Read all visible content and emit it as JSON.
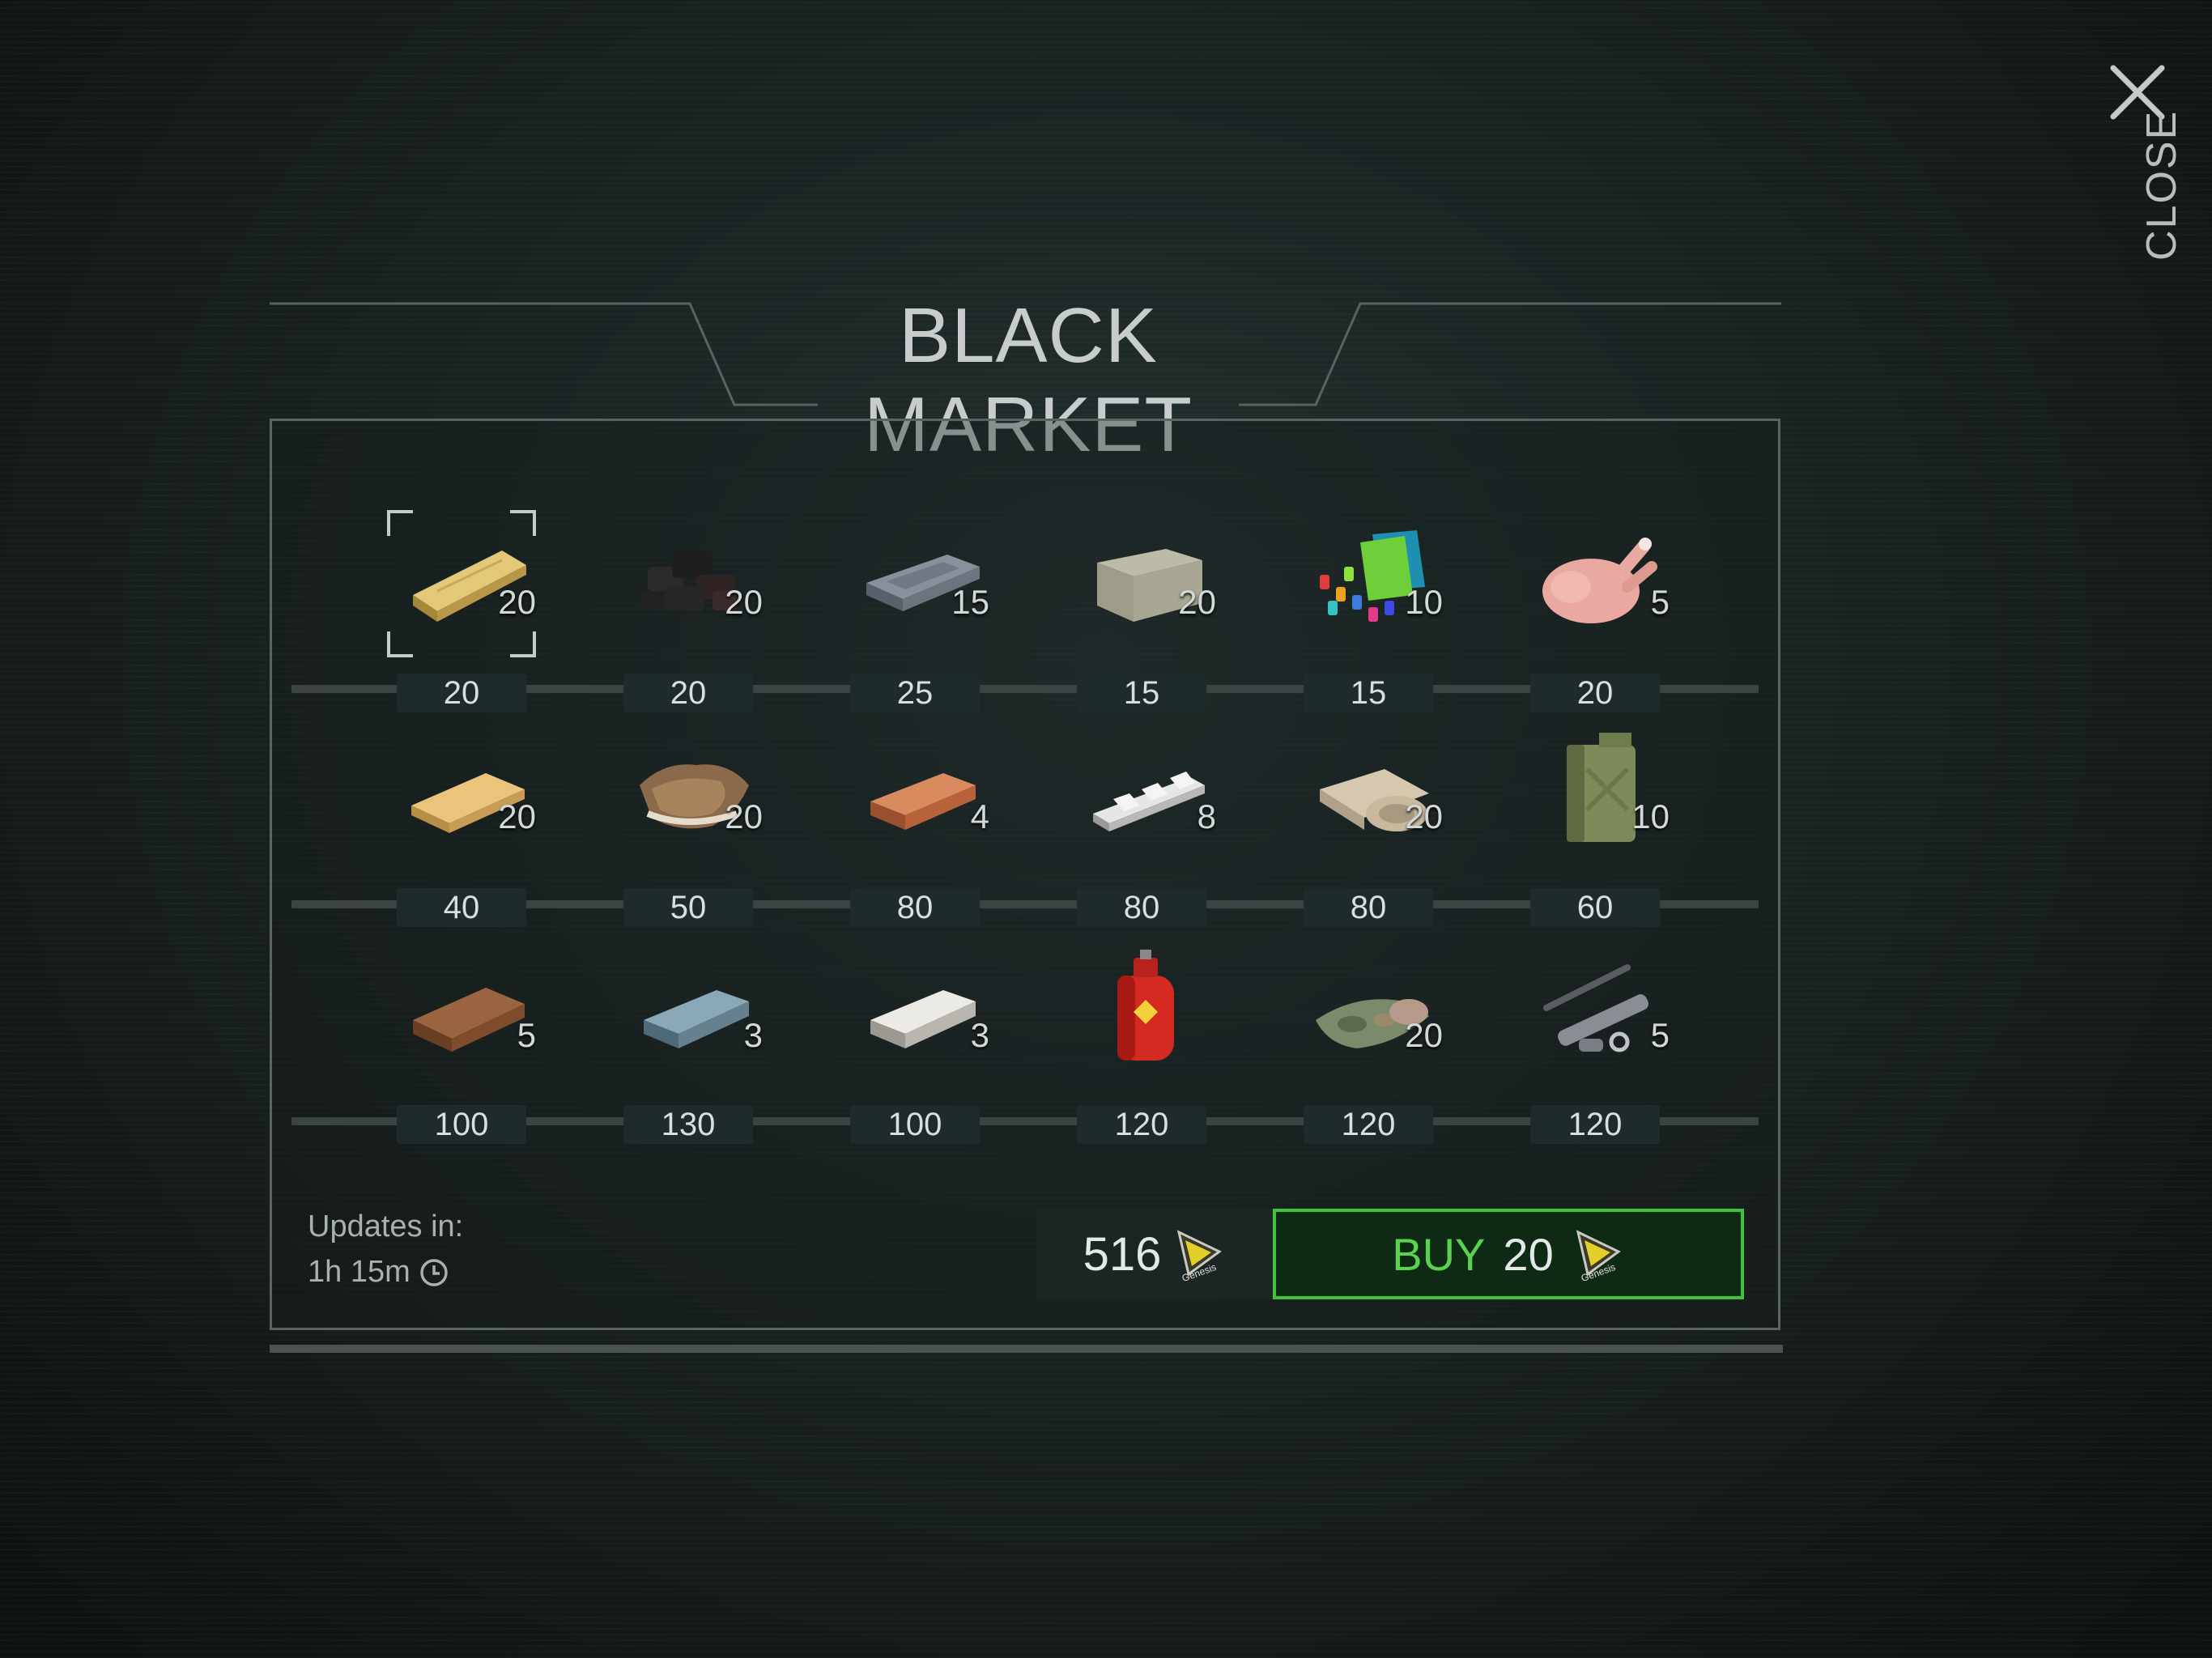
{
  "close": {
    "label": "CLOSE"
  },
  "title": "BLACK MARKET",
  "rows": [
    {
      "items": [
        {
          "icon": "wood-plank-icon",
          "qty": "20",
          "price": "20",
          "selected": true
        },
        {
          "icon": "coal-icon",
          "qty": "20",
          "price": "20"
        },
        {
          "icon": "iron-ingot-icon",
          "qty": "15",
          "price": "25"
        },
        {
          "icon": "stone-block-icon",
          "qty": "20",
          "price": "15"
        },
        {
          "icon": "plastic-parts-icon",
          "qty": "10",
          "price": "15"
        },
        {
          "icon": "raw-chicken-icon",
          "qty": "5",
          "price": "20"
        }
      ]
    },
    {
      "items": [
        {
          "icon": "oak-plank-icon",
          "qty": "20",
          "price": "40"
        },
        {
          "icon": "leather-hide-icon",
          "qty": "20",
          "price": "50"
        },
        {
          "icon": "copper-ingot-icon",
          "qty": "4",
          "price": "80"
        },
        {
          "icon": "aluminum-bars-icon",
          "qty": "8",
          "price": "80"
        },
        {
          "icon": "fabric-roll-icon",
          "qty": "20",
          "price": "80"
        },
        {
          "icon": "jerry-can-icon",
          "qty": "10",
          "price": "60"
        }
      ]
    },
    {
      "items": [
        {
          "icon": "hardwood-plank-icon",
          "qty": "5",
          "price": "100"
        },
        {
          "icon": "steel-ingot-icon",
          "qty": "3",
          "price": "130"
        },
        {
          "icon": "silver-ingot-icon",
          "qty": "3",
          "price": "100"
        },
        {
          "icon": "gas-cylinder-icon",
          "qty": "",
          "price": "120"
        },
        {
          "icon": "camo-fabric-icon",
          "qty": "20",
          "price": "120"
        },
        {
          "icon": "weapon-parts-icon",
          "qty": "5",
          "price": "120"
        }
      ]
    }
  ],
  "updates": {
    "label": "Updates in:",
    "time": "1h 15m"
  },
  "balance": {
    "value": "516",
    "currency_icon": "genesis-coin-icon"
  },
  "buy": {
    "label": "BUY",
    "amount": "20"
  },
  "colors": {
    "accent": "#3fc33a",
    "buy_text": "#5ad24f",
    "background": "#18201f"
  }
}
